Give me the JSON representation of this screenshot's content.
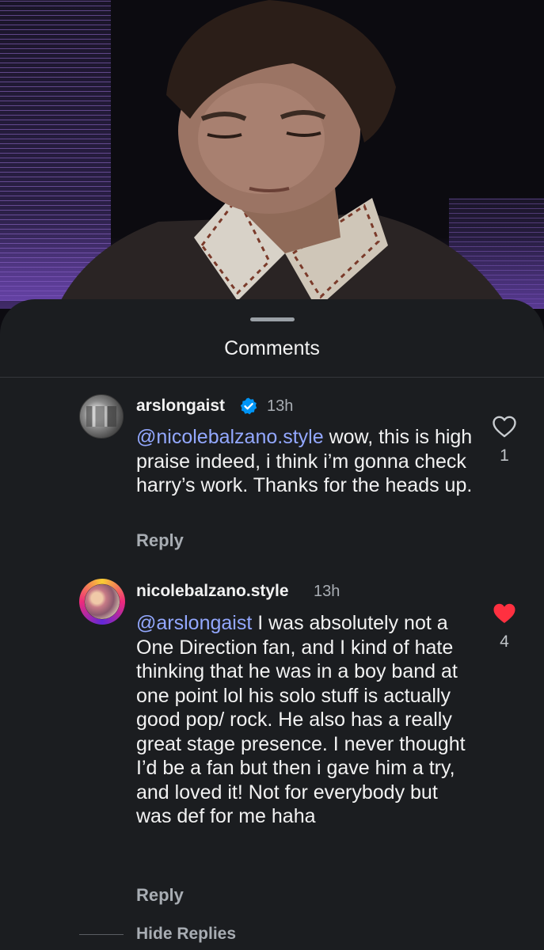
{
  "sheet": {
    "title": "Comments"
  },
  "comments": [
    {
      "username": "arslongaist",
      "verified": true,
      "time": "13h",
      "mention": "@nicolebalzano.style",
      "text": " wow, this is high praise indeed, i think i’m gonna check harry’s work. Thanks for the heads up.",
      "reply_label": "Reply",
      "likes": "1",
      "liked": false
    },
    {
      "username": "nicolebalzano.style",
      "verified": false,
      "time": "13h",
      "mention": "@arslongaist",
      "text": " I was absolutely not a One Direction fan, and I kind of hate thinking that he was in a boy band at one point lol his solo stuff is actually good pop/ rock. He also has a really great stage presence. I never thought I’d be a fan but then i gave him a try, and loved it! Not for everybody but was def for me haha",
      "reply_label": "Reply",
      "likes": "4",
      "liked": true
    }
  ],
  "hide_replies_label": "Hide Replies",
  "colors": {
    "background": "#1b1d20",
    "mention": "#93a8ff",
    "like_active": "#ff3040",
    "verified": "#0095f6"
  }
}
